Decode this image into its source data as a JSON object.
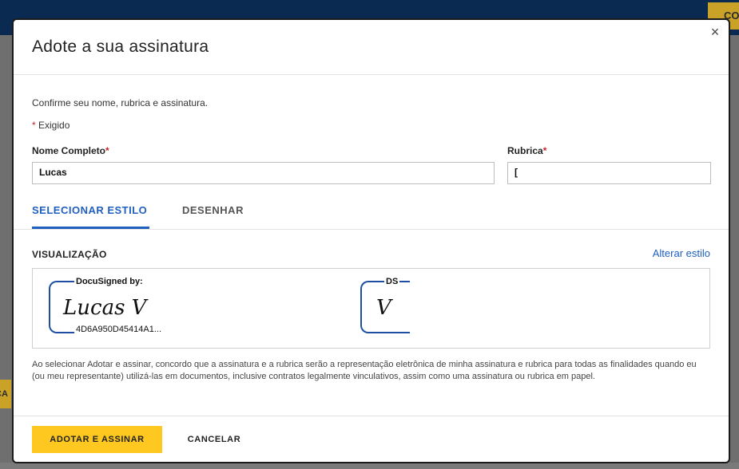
{
  "background": {
    "top_right_button": "CO",
    "left_button": "ÇA"
  },
  "modal": {
    "title": "Adote a sua assinatura",
    "close_glyph": "×",
    "intro": "Confirme seu nome, rubrica e assinatura.",
    "required_star": "*",
    "required_text": "Exigido",
    "full_name_label": "Nome Completo",
    "full_name_value": "Lucas",
    "initials_label": "Rubrica",
    "initials_value": "[",
    "tabs": [
      {
        "label": "SELECIONAR ESTILO",
        "active": true
      },
      {
        "label": "DESENHAR",
        "active": false
      }
    ],
    "preview_label": "VISUALIZAÇÃO",
    "change_style": "Alterar estilo",
    "signature": {
      "header": "DocuSigned by:",
      "script": "Lucas V",
      "hash": "4D6A950D45414A1..."
    },
    "initials_preview": {
      "header": "DS",
      "script": "V"
    },
    "legal_text": "Ao selecionar Adotar e assinar, concordo que a assinatura e a rubrica serão a representação eletrônica de minha assinatura e rubrica para todas as finalidades quando eu (ou meu representante) utilizá-las em documentos, inclusive contratos legalmente vinculativos, assim como uma assinatura ou rubrica em papel.",
    "adopt_button": "ADOTAR E ASSINAR",
    "cancel_button": "CANCELAR"
  },
  "colors": {
    "accent": "#1f5fbf",
    "primary_button": "#ffc820",
    "required": "#c4262e",
    "signature_frame": "#1e4fa3"
  }
}
